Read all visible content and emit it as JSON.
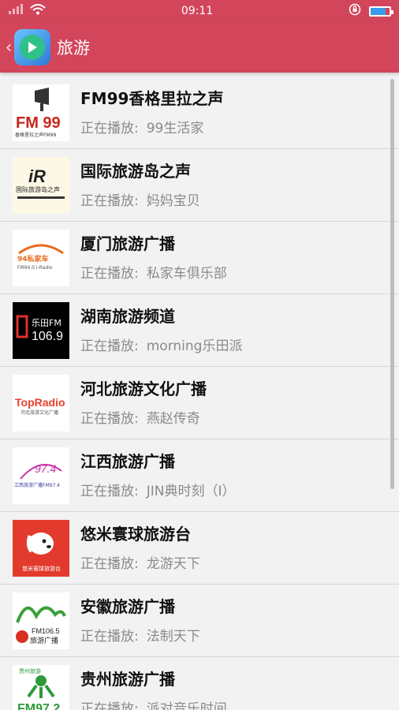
{
  "status": {
    "time": "09:11"
  },
  "app_bar": {
    "title": "旅游"
  },
  "now_playing_label": "正在播放:",
  "stations": [
    {
      "name": "FM99香格里拉之声",
      "program": "99生活家"
    },
    {
      "name": "国际旅游岛之声",
      "program": "妈妈宝贝"
    },
    {
      "name": "厦门旅游广播",
      "program": "私家车俱乐部"
    },
    {
      "name": "湖南旅游频道",
      "program": "morning乐田派"
    },
    {
      "name": "河北旅游文化广播",
      "program": "燕赵传奇"
    },
    {
      "name": "江西旅游广播",
      "program": "JIN典时刻（I）"
    },
    {
      "name": "悠米寰球旅游台",
      "program": "龙游天下"
    },
    {
      "name": "安徽旅游广播",
      "program": "法制天下"
    },
    {
      "name": "贵州旅游广播",
      "program": "派对音乐时间"
    }
  ],
  "logos": {
    "fm99": {
      "big": "FM 99",
      "small": "香格里拉之声FM99"
    },
    "hainan": {
      "big": "iR",
      "small": "国际旅游岛之声"
    },
    "xiamen": {
      "big": "94私家车",
      "small": "FM94.0 i-Radio"
    },
    "hunan": {
      "big": "106.9",
      "small": "乐田FM"
    },
    "hebei": {
      "big": "TopRadio",
      "small": "河北旅游文化广播"
    },
    "jiangxi": {
      "big": "97.4",
      "small": "江西旅游广播FM97.4"
    },
    "youmi": {
      "small": "悠米寰球旅游台"
    },
    "anhui": {
      "big": "FM106.5",
      "small": "旅游广播"
    },
    "guizhou": {
      "big": "FM97.2",
      "small": "贵州旅游"
    }
  },
  "colors": {
    "accent": "#d2455a"
  }
}
